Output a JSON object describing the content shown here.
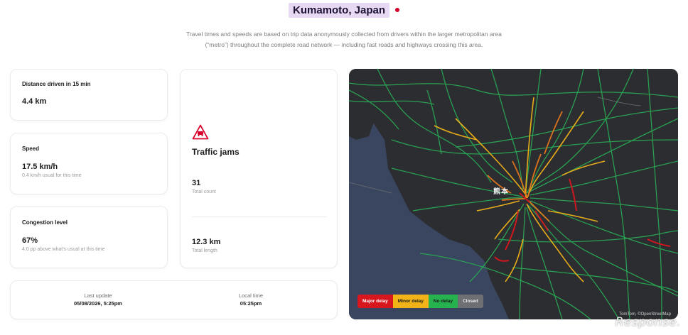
{
  "header": {
    "city": "Kumamoto, Japan",
    "description_line1": "Travel times and speeds are based on trip data anonymously collected from drivers within the larger metropolitan area",
    "description_line2": "(“metro”) throughout the complete road network — including fast roads and highways crossing this area."
  },
  "distance": {
    "label": "Distance driven in 15 min",
    "value": "4.4 km"
  },
  "speed": {
    "label": "Speed",
    "value": "17.5 km/h",
    "sub": "0.4 km/h usual for this time"
  },
  "congestion": {
    "label": "Congestion level",
    "value": "67%",
    "sub": "4.0 pp above what's usual at this time"
  },
  "jams": {
    "icon": "traffic-jam-warning-icon",
    "title": "Traffic jams",
    "count": "31",
    "count_label": "Total count",
    "length": "12.3 km",
    "length_label": "Total length"
  },
  "update": {
    "last_update_label": "Last update",
    "last_update_value": "05/08/2026, 5:25pm",
    "local_time_label": "Local time",
    "local_time_value": "05:25pm"
  },
  "map": {
    "city_label": "熊本",
    "legend": [
      "Major delay",
      "Minor delay",
      "No delay",
      "Closed"
    ],
    "attribution": "TomTom, ©OpenStreetMap",
    "colors": {
      "major": "#d8161d",
      "minor": "#f2b318",
      "none": "#26b24f",
      "closed": "#6e6f73",
      "accent": "#d6002a"
    }
  },
  "watermark": "Response."
}
